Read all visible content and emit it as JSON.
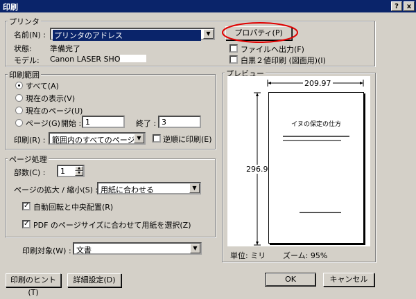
{
  "window": {
    "title": "印刷",
    "help_btn": "?",
    "close_btn": "x"
  },
  "printer": {
    "legend": "プリンタ",
    "name_label": "名前(N) :",
    "name_value": "プリンタのアドレス",
    "properties_button": "プロパティ(P)",
    "status_label": "状態:",
    "status_value": "準備完了",
    "model_label": "モデル:",
    "model_value": "Canon LASER SHOT",
    "print_to_file": "ファイルへ出力(F)",
    "bw_print": "白黒２値印刷 (図面用)(I)"
  },
  "range": {
    "legend": "印刷範囲",
    "all": "すべて(A)",
    "current_view": "現在の表示(V)",
    "current_page": "現在のページ(U)",
    "pages": "ページ(G)",
    "start_label": "開始 :",
    "start_value": "1",
    "end_label": "終了 :",
    "end_value": "3",
    "print_label": "印刷(R) :",
    "print_value": "範囲内のすべてのページ",
    "reverse": "逆順に印刷(E)"
  },
  "page_handling": {
    "legend": "ページ処理",
    "copies_label": "部数(C) :",
    "copies_value": "1",
    "scaling_label": "ページの拡大 / 縮小(S) :",
    "scaling_value": "用紙に合わせる",
    "auto_rotate": "自動回転と中央配置(R)",
    "pdf_page_size": "PDF のページサイズに合わせて用紙を選択(Z)"
  },
  "print_what": {
    "label": "印刷対象(W) :",
    "value": "文書"
  },
  "preview": {
    "legend": "プレビュー",
    "width": "209.97",
    "height": "296.93",
    "doc_title": "イヌの保定の仕方",
    "unit": "単位: ミリ",
    "zoom": "ズーム: 95%"
  },
  "buttons": {
    "hint": "印刷のヒント(T)",
    "advanced": "詳細設定(D)",
    "ok": "OK",
    "cancel": "キャンセル"
  },
  "colors": {
    "titlebar": "#0a246a",
    "dialog_bg": "#d4d0c8",
    "highlight_circle": "#e00000"
  }
}
